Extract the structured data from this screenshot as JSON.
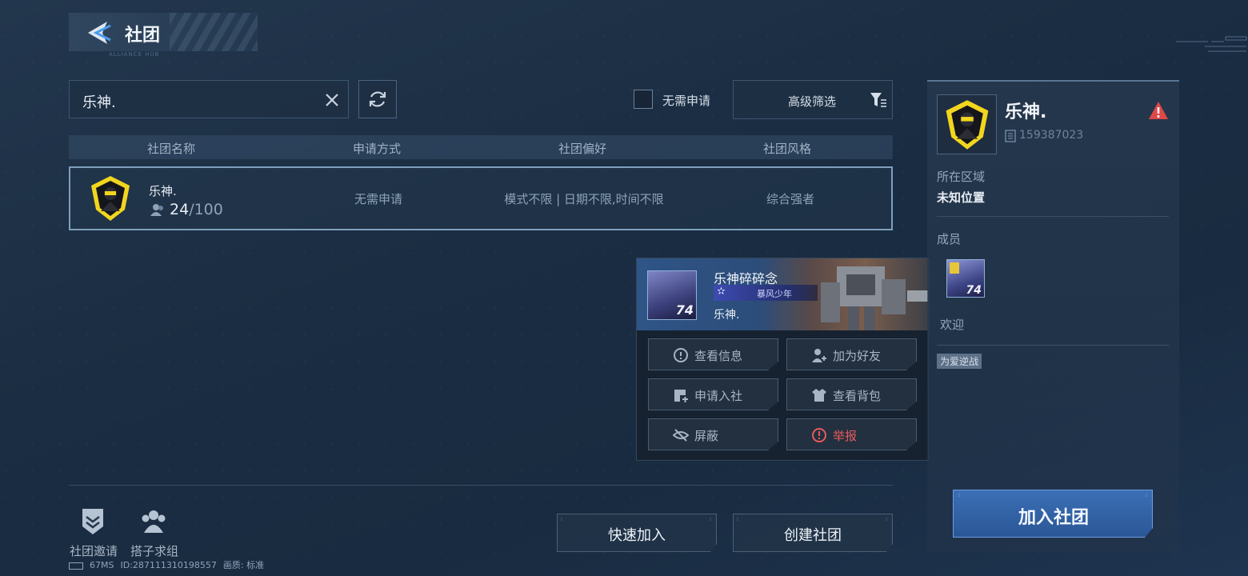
{
  "header": {
    "title": "社团",
    "subtitle": "ALLIANCE HUB"
  },
  "search": {
    "value": "乐神.",
    "no_application_label": "无需申请",
    "no_application_checked": false,
    "advanced_filter_label": "高级筛选"
  },
  "table": {
    "columns": [
      "社团名称",
      "申请方式",
      "社团偏好",
      "社团风格"
    ],
    "rows": [
      {
        "name": "乐神.",
        "member_count": "24",
        "member_max": "/100",
        "apply_method": "无需申请",
        "preference": "模式不限 | 日期不限,时间不限",
        "style": "综合强者"
      }
    ]
  },
  "player_popup": {
    "name": "乐神碎碎念",
    "title": "暴风少年",
    "club": "乐神.",
    "level": "74",
    "actions": {
      "view_info": "查看信息",
      "add_friend": "加为好友",
      "apply_join": "申请入社",
      "view_bag": "查看背包",
      "block": "屏蔽",
      "report": "举报"
    }
  },
  "detail": {
    "name": "乐神.",
    "club_id": "159387023",
    "region_label": "所在区域",
    "region_value": "未知位置",
    "members_label": "成员",
    "member_level": "74",
    "welcome_label": "欢迎",
    "tag": "为爱逆战",
    "join_label": "加入社团"
  },
  "bottom": {
    "quick_join": "快速加入",
    "create_club": "创建社团",
    "club_invite": "社团邀请",
    "partner_group": "搭子求组"
  },
  "status": {
    "ping": "67MS",
    "id": "ID:287111310198557",
    "quality": "画质:  标准"
  },
  "colors": {
    "accent_blue": "#2b5796",
    "report_red": "#e85a5a",
    "emblem_yellow": "#f2d61e"
  }
}
